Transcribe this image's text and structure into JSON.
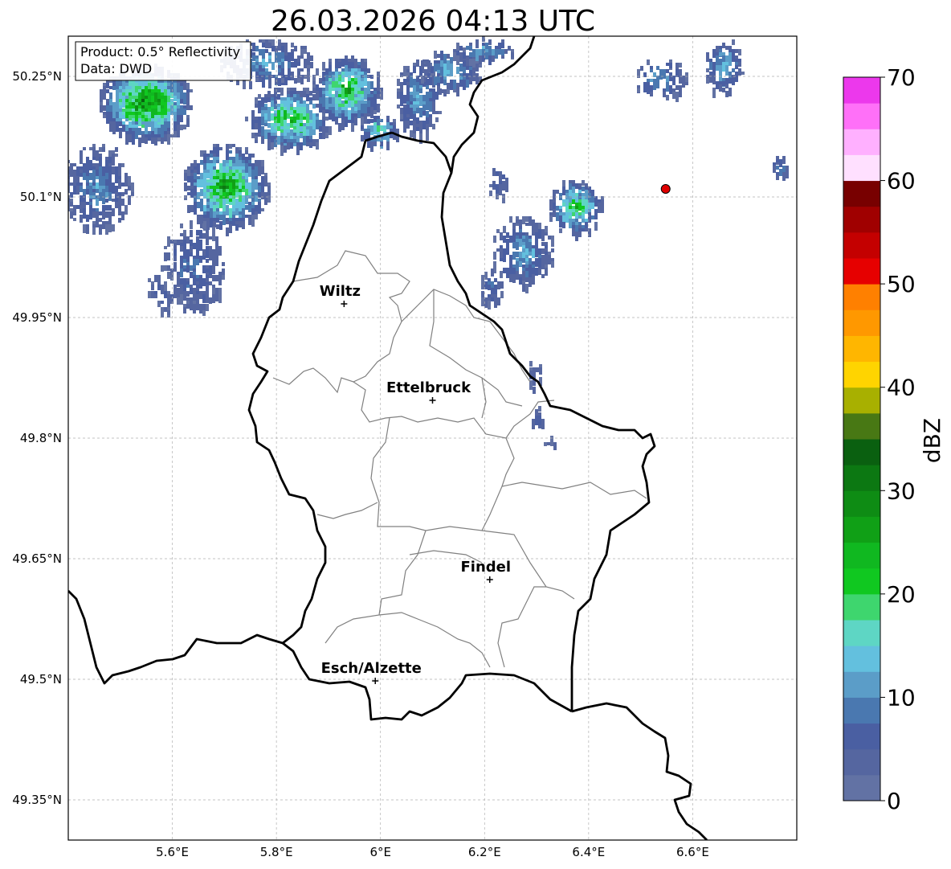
{
  "title": "26.03.2026 04:13 UTC",
  "info": {
    "product": "Product: 0.5° Reflectivity",
    "source": "Data: DWD"
  },
  "axes": {
    "lon_min": 5.4,
    "lon_max": 6.8,
    "lat_min": 49.3,
    "lat_max": 50.3,
    "x_ticks": [
      {
        "v": 5.6,
        "label": "5.6°E"
      },
      {
        "v": 5.8,
        "label": "5.8°E"
      },
      {
        "v": 6.0,
        "label": "6°E"
      },
      {
        "v": 6.2,
        "label": "6.2°E"
      },
      {
        "v": 6.4,
        "label": "6.4°E"
      },
      {
        "v": 6.6,
        "label": "6.6°E"
      }
    ],
    "y_ticks": [
      {
        "v": 50.25,
        "label": "50.25°N"
      },
      {
        "v": 50.1,
        "label": "50.1°N"
      },
      {
        "v": 49.95,
        "label": "49.95°N"
      },
      {
        "v": 49.8,
        "label": "49.8°N"
      },
      {
        "v": 49.65,
        "label": "49.65°N"
      },
      {
        "v": 49.5,
        "label": "49.5°N"
      },
      {
        "v": 49.35,
        "label": "49.35°N"
      }
    ]
  },
  "cities": [
    {
      "name": "Wiltz",
      "lon": 5.93,
      "lat": 49.967
    },
    {
      "name": "Ettelbruck",
      "lon": 6.1,
      "lat": 49.847
    },
    {
      "name": "Findel",
      "lon": 6.21,
      "lat": 49.624
    },
    {
      "name": "Esch/Alzette",
      "lon": 5.99,
      "lat": 49.498
    }
  ],
  "radar_site": {
    "lon": 6.548,
    "lat": 50.11
  },
  "colorbar": {
    "unit": "dBZ",
    "min": 0,
    "max": 70,
    "step": 2.5,
    "tick_labels": [
      "0",
      "10",
      "20",
      "30",
      "40",
      "50",
      "60",
      "70"
    ],
    "colors": [
      "#6272a4",
      "#5566a0",
      "#4a5fa2",
      "#4a78b0",
      "#5b9dc8",
      "#63c0de",
      "#5ed6c4",
      "#3ed66e",
      "#10c820",
      "#10b820",
      "#10a016",
      "#0e8c14",
      "#0c7812",
      "#0a6010",
      "#487814",
      "#a8b000",
      "#ffd400",
      "#ffb600",
      "#ff9800",
      "#ff8000",
      "#e60000",
      "#c40000",
      "#a00000",
      "#780000",
      "#ffe0ff",
      "#ffb0ff",
      "#ff70f8",
      "#ec38ec"
    ]
  }
}
